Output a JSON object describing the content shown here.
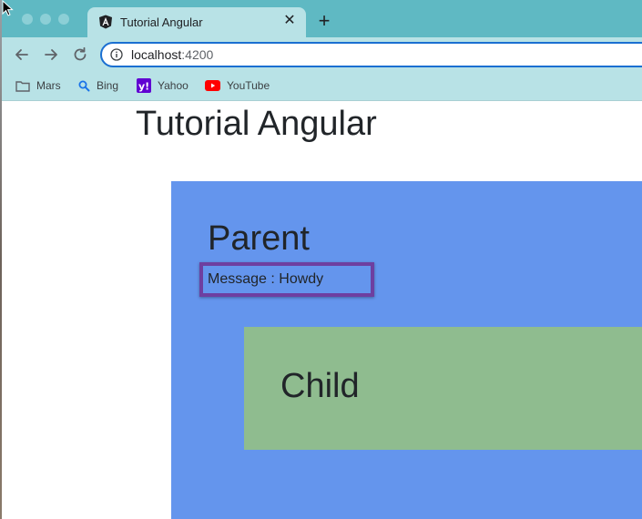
{
  "browser": {
    "tab": {
      "title": "Tutorial Angular",
      "favicon": "angular-icon",
      "close_icon": "close-icon"
    },
    "new_tab_icon": "plus-icon",
    "toolbar": {
      "back_icon": "back-arrow-icon",
      "forward_icon": "forward-arrow-icon",
      "reload_icon": "reload-icon",
      "url_host": "localhost",
      "url_port": ":4200"
    },
    "bookmarks": [
      {
        "label": "Mars",
        "icon": "folder-icon"
      },
      {
        "label": "Bing",
        "icon": "search-icon"
      },
      {
        "label": "Yahoo",
        "icon": "yahoo-icon"
      },
      {
        "label": "YouTube",
        "icon": "youtube-icon"
      }
    ]
  },
  "page": {
    "title": "Tutorial Angular",
    "parent": {
      "heading": "Parent",
      "message": "Message : Howdy"
    },
    "child": {
      "heading": "Child"
    }
  },
  "colors": {
    "tabstrip": "#5fb9c3",
    "toolbar": "#b8e2e6",
    "parent_bg": "#6495ed",
    "child_bg": "#8fbc8f",
    "highlight_border": "#6e3fa0"
  }
}
